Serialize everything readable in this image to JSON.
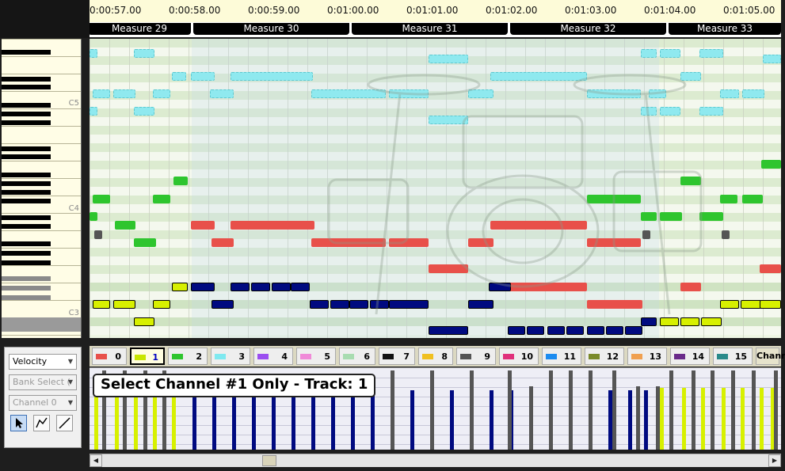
{
  "timeline": {
    "times": [
      "0:00:57.00",
      "0:00:58.00",
      "0:00:59.00",
      "0:01:00.00",
      "0:01:01.00",
      "0:01:02.00",
      "0:01:03.00",
      "0:01:04.00",
      "0:01:05.00"
    ],
    "measures": [
      "Measure 29",
      "Measure 30",
      "Measure 31",
      "Measure 32",
      "Measure 33"
    ]
  },
  "keyboard": {
    "labels": {
      "c5": "C5",
      "c4": "C4",
      "c3": "C3"
    }
  },
  "channels": {
    "items": [
      {
        "label": "0",
        "color": "#e8504a"
      },
      {
        "label": "1",
        "color": "#c8e600"
      },
      {
        "label": "2",
        "color": "#2ec52e"
      },
      {
        "label": "3",
        "color": "#7fe9f0"
      },
      {
        "label": "4",
        "color": "#9b4ef0"
      },
      {
        "label": "5",
        "color": "#f08ad8"
      },
      {
        "label": "6",
        "color": "#a8dcb0"
      },
      {
        "label": "7",
        "color": "#111111"
      },
      {
        "label": "8",
        "color": "#f0c020"
      },
      {
        "label": "9",
        "color": "#555555"
      },
      {
        "label": "10",
        "color": "#e0307a"
      },
      {
        "label": "11",
        "color": "#1c8cf0"
      },
      {
        "label": "12",
        "color": "#7a8a2a"
      },
      {
        "label": "13",
        "color": "#f0a050"
      },
      {
        "label": "14",
        "color": "#6a2a8a"
      },
      {
        "label": "15",
        "color": "#2a8a8a"
      }
    ],
    "selected": "1",
    "all_label": "Channels"
  },
  "controls": {
    "velocity": "Velocity",
    "bank_select": "Bank Select (",
    "channel": "Channel 0"
  },
  "tooltip": "Select Channel #1 Only - Track: 1",
  "colors": {
    "cyan": "#8fe9ef",
    "green": "#2ec52e",
    "red": "#e8504a",
    "navy": "#000a80",
    "yellow": "#d7f000",
    "gray": "#555555"
  }
}
